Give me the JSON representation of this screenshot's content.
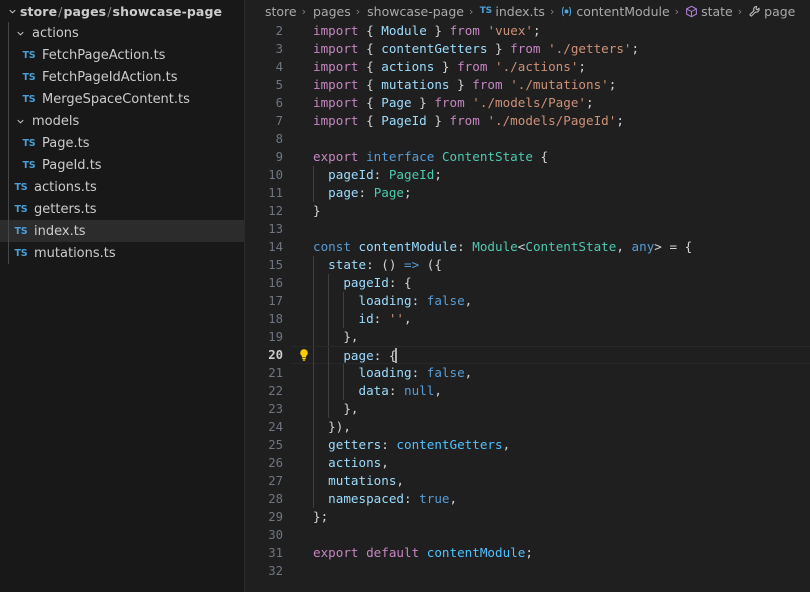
{
  "colors": {
    "editor_bg": "#1f1f1f",
    "sidebar_bg": "#181818",
    "selection_bg": "#2c2c2c",
    "accent_blue": "#4a9fd8",
    "lightbulb": "#ffcc00",
    "keyword": "#c586c0",
    "control": "#569cd6",
    "variable": "#9cdcfe",
    "type": "#4ec9b0",
    "string": "#ce9178",
    "punctuation": "#d4d4d4"
  },
  "sidebar": {
    "header": {
      "parts": [
        "store",
        "pages",
        "showcase-page"
      ],
      "separator": "/",
      "expanded": true
    },
    "items": [
      {
        "label": "actions",
        "kind": "folder",
        "depth": 1,
        "expanded": true,
        "selected": false
      },
      {
        "label": "FetchPageAction.ts",
        "kind": "file",
        "depth": 2,
        "selected": false
      },
      {
        "label": "FetchPageIdAction.ts",
        "kind": "file",
        "depth": 2,
        "selected": false
      },
      {
        "label": "MergeSpaceContent.ts",
        "kind": "file",
        "depth": 2,
        "selected": false
      },
      {
        "label": "models",
        "kind": "folder",
        "depth": 1,
        "expanded": true,
        "selected": false
      },
      {
        "label": "Page.ts",
        "kind": "file",
        "depth": 2,
        "selected": false
      },
      {
        "label": "PageId.ts",
        "kind": "file",
        "depth": 2,
        "selected": false
      },
      {
        "label": "actions.ts",
        "kind": "file",
        "depth": 1,
        "selected": false
      },
      {
        "label": "getters.ts",
        "kind": "file",
        "depth": 1,
        "selected": false
      },
      {
        "label": "index.ts",
        "kind": "file",
        "depth": 1,
        "selected": true
      },
      {
        "label": "mutations.ts",
        "kind": "file",
        "depth": 1,
        "selected": false
      }
    ],
    "file_icon_text": "TS"
  },
  "breadcrumbs": {
    "separator": "›",
    "items": [
      {
        "label": "store",
        "icon": "none"
      },
      {
        "label": "pages",
        "icon": "none"
      },
      {
        "label": "showcase-page",
        "icon": "none"
      },
      {
        "label": "index.ts",
        "icon": "typescript-file-icon",
        "icon_text": "TS"
      },
      {
        "label": "contentModule",
        "icon": "variable-symbol-icon",
        "icon_text": "[●]"
      },
      {
        "label": "state",
        "icon": "object-symbol-icon",
        "icon_text": "cube"
      },
      {
        "label": "page",
        "icon": "property-symbol-icon",
        "icon_text": "wrench"
      }
    ]
  },
  "editor": {
    "first_visible_line": 2,
    "active_line": 20,
    "lightbulb_line": 20,
    "cursor": {
      "line": 20,
      "after": "page: {"
    },
    "lines": [
      {
        "n": 2,
        "guides": [],
        "tokens": [
          {
            "t": "import",
            "c": "t-kw"
          },
          {
            "t": " ",
            "c": "t-pun"
          },
          {
            "t": "{",
            "c": "t-pun"
          },
          {
            "t": " ",
            "c": "t-pun"
          },
          {
            "t": "Module",
            "c": "t-var"
          },
          {
            "t": " ",
            "c": "t-pun"
          },
          {
            "t": "}",
            "c": "t-pun"
          },
          {
            "t": " ",
            "c": "t-pun"
          },
          {
            "t": "from",
            "c": "t-kw"
          },
          {
            "t": " ",
            "c": "t-pun"
          },
          {
            "t": "'vuex'",
            "c": "t-str"
          },
          {
            "t": ";",
            "c": "t-pun"
          }
        ]
      },
      {
        "n": 3,
        "guides": [],
        "tokens": [
          {
            "t": "import",
            "c": "t-kw"
          },
          {
            "t": " { ",
            "c": "t-pun"
          },
          {
            "t": "contentGetters",
            "c": "t-var"
          },
          {
            "t": " } ",
            "c": "t-pun"
          },
          {
            "t": "from",
            "c": "t-kw"
          },
          {
            "t": " ",
            "c": "t-pun"
          },
          {
            "t": "'./getters'",
            "c": "t-str"
          },
          {
            "t": ";",
            "c": "t-pun"
          }
        ]
      },
      {
        "n": 4,
        "guides": [],
        "tokens": [
          {
            "t": "import",
            "c": "t-kw"
          },
          {
            "t": " { ",
            "c": "t-pun"
          },
          {
            "t": "actions",
            "c": "t-var"
          },
          {
            "t": " } ",
            "c": "t-pun"
          },
          {
            "t": "from",
            "c": "t-kw"
          },
          {
            "t": " ",
            "c": "t-pun"
          },
          {
            "t": "'./actions'",
            "c": "t-str"
          },
          {
            "t": ";",
            "c": "t-pun"
          }
        ]
      },
      {
        "n": 5,
        "guides": [],
        "tokens": [
          {
            "t": "import",
            "c": "t-kw"
          },
          {
            "t": " { ",
            "c": "t-pun"
          },
          {
            "t": "mutations",
            "c": "t-var"
          },
          {
            "t": " } ",
            "c": "t-pun"
          },
          {
            "t": "from",
            "c": "t-kw"
          },
          {
            "t": " ",
            "c": "t-pun"
          },
          {
            "t": "'./mutations'",
            "c": "t-str"
          },
          {
            "t": ";",
            "c": "t-pun"
          }
        ]
      },
      {
        "n": 6,
        "guides": [],
        "tokens": [
          {
            "t": "import",
            "c": "t-kw"
          },
          {
            "t": " { ",
            "c": "t-pun"
          },
          {
            "t": "Page",
            "c": "t-var"
          },
          {
            "t": " } ",
            "c": "t-pun"
          },
          {
            "t": "from",
            "c": "t-kw"
          },
          {
            "t": " ",
            "c": "t-pun"
          },
          {
            "t": "'./models/Page'",
            "c": "t-str"
          },
          {
            "t": ";",
            "c": "t-pun"
          }
        ]
      },
      {
        "n": 7,
        "guides": [],
        "tokens": [
          {
            "t": "import",
            "c": "t-kw"
          },
          {
            "t": " { ",
            "c": "t-pun"
          },
          {
            "t": "PageId",
            "c": "t-var"
          },
          {
            "t": " } ",
            "c": "t-pun"
          },
          {
            "t": "from",
            "c": "t-kw"
          },
          {
            "t": " ",
            "c": "t-pun"
          },
          {
            "t": "'./models/PageId'",
            "c": "t-str"
          },
          {
            "t": ";",
            "c": "t-pun"
          }
        ]
      },
      {
        "n": 8,
        "guides": [],
        "tokens": []
      },
      {
        "n": 9,
        "guides": [],
        "tokens": [
          {
            "t": "export",
            "c": "t-kw"
          },
          {
            "t": " ",
            "c": "t-pun"
          },
          {
            "t": "interface",
            "c": "t-ctl"
          },
          {
            "t": " ",
            "c": "t-pun"
          },
          {
            "t": "ContentState",
            "c": "t-type"
          },
          {
            "t": " {",
            "c": "t-pun"
          }
        ]
      },
      {
        "n": 10,
        "guides": [
          0
        ],
        "tokens": [
          {
            "t": "  ",
            "c": "t-pun"
          },
          {
            "t": "pageId",
            "c": "t-var"
          },
          {
            "t": ": ",
            "c": "t-pun"
          },
          {
            "t": "PageId",
            "c": "t-type"
          },
          {
            "t": ";",
            "c": "t-pun"
          }
        ]
      },
      {
        "n": 11,
        "guides": [
          0
        ],
        "tokens": [
          {
            "t": "  ",
            "c": "t-pun"
          },
          {
            "t": "page",
            "c": "t-var"
          },
          {
            "t": ": ",
            "c": "t-pun"
          },
          {
            "t": "Page",
            "c": "t-type"
          },
          {
            "t": ";",
            "c": "t-pun"
          }
        ]
      },
      {
        "n": 12,
        "guides": [],
        "tokens": [
          {
            "t": "}",
            "c": "t-pun"
          }
        ]
      },
      {
        "n": 13,
        "guides": [],
        "tokens": []
      },
      {
        "n": 14,
        "guides": [],
        "tokens": [
          {
            "t": "const",
            "c": "t-ctl"
          },
          {
            "t": " ",
            "c": "t-pun"
          },
          {
            "t": "contentModule",
            "c": "t-var"
          },
          {
            "t": ": ",
            "c": "t-pun"
          },
          {
            "t": "Module",
            "c": "t-type"
          },
          {
            "t": "<",
            "c": "t-pun"
          },
          {
            "t": "ContentState",
            "c": "t-type"
          },
          {
            "t": ", ",
            "c": "t-pun"
          },
          {
            "t": "any",
            "c": "t-ctl"
          },
          {
            "t": "> = {",
            "c": "t-pun"
          }
        ]
      },
      {
        "n": 15,
        "guides": [
          0
        ],
        "tokens": [
          {
            "t": "  ",
            "c": "t-pun"
          },
          {
            "t": "state",
            "c": "t-var"
          },
          {
            "t": ": () ",
            "c": "t-pun"
          },
          {
            "t": "=>",
            "c": "t-op"
          },
          {
            "t": " ({",
            "c": "t-pun"
          }
        ]
      },
      {
        "n": 16,
        "guides": [
          0,
          1
        ],
        "tokens": [
          {
            "t": "    ",
            "c": "t-pun"
          },
          {
            "t": "pageId",
            "c": "t-var"
          },
          {
            "t": ": {",
            "c": "t-pun"
          }
        ]
      },
      {
        "n": 17,
        "guides": [
          0,
          1,
          2
        ],
        "tokens": [
          {
            "t": "      ",
            "c": "t-pun"
          },
          {
            "t": "loading",
            "c": "t-var"
          },
          {
            "t": ": ",
            "c": "t-pun"
          },
          {
            "t": "false",
            "c": "t-ctl"
          },
          {
            "t": ",",
            "c": "t-pun"
          }
        ]
      },
      {
        "n": 18,
        "guides": [
          0,
          1,
          2
        ],
        "tokens": [
          {
            "t": "      ",
            "c": "t-pun"
          },
          {
            "t": "id",
            "c": "t-var"
          },
          {
            "t": ": ",
            "c": "t-pun"
          },
          {
            "t": "''",
            "c": "t-str"
          },
          {
            "t": ",",
            "c": "t-pun"
          }
        ]
      },
      {
        "n": 19,
        "guides": [
          0,
          1
        ],
        "tokens": [
          {
            "t": "    },",
            "c": "t-pun"
          }
        ]
      },
      {
        "n": 20,
        "guides": [
          0,
          1
        ],
        "tokens": [
          {
            "t": "    ",
            "c": "t-pun"
          },
          {
            "t": "page",
            "c": "t-var"
          },
          {
            "t": ": {",
            "c": "t-pun"
          }
        ]
      },
      {
        "n": 21,
        "guides": [
          0,
          1,
          2
        ],
        "tokens": [
          {
            "t": "      ",
            "c": "t-pun"
          },
          {
            "t": "loading",
            "c": "t-var"
          },
          {
            "t": ": ",
            "c": "t-pun"
          },
          {
            "t": "false",
            "c": "t-ctl"
          },
          {
            "t": ",",
            "c": "t-pun"
          }
        ]
      },
      {
        "n": 22,
        "guides": [
          0,
          1,
          2
        ],
        "tokens": [
          {
            "t": "      ",
            "c": "t-pun"
          },
          {
            "t": "data",
            "c": "t-var"
          },
          {
            "t": ": ",
            "c": "t-pun"
          },
          {
            "t": "null",
            "c": "t-ctl"
          },
          {
            "t": ",",
            "c": "t-pun"
          }
        ]
      },
      {
        "n": 23,
        "guides": [
          0,
          1
        ],
        "tokens": [
          {
            "t": "    },",
            "c": "t-pun"
          }
        ]
      },
      {
        "n": 24,
        "guides": [
          0
        ],
        "tokens": [
          {
            "t": "  }),",
            "c": "t-pun"
          }
        ]
      },
      {
        "n": 25,
        "guides": [
          0
        ],
        "tokens": [
          {
            "t": "  ",
            "c": "t-pun"
          },
          {
            "t": "getters",
            "c": "t-var"
          },
          {
            "t": ": ",
            "c": "t-pun"
          },
          {
            "t": "contentGetters",
            "c": "t-fn"
          },
          {
            "t": ",",
            "c": "t-pun"
          }
        ]
      },
      {
        "n": 26,
        "guides": [
          0
        ],
        "tokens": [
          {
            "t": "  ",
            "c": "t-pun"
          },
          {
            "t": "actions",
            "c": "t-var"
          },
          {
            "t": ",",
            "c": "t-pun"
          }
        ]
      },
      {
        "n": 27,
        "guides": [
          0
        ],
        "tokens": [
          {
            "t": "  ",
            "c": "t-pun"
          },
          {
            "t": "mutations",
            "c": "t-var"
          },
          {
            "t": ",",
            "c": "t-pun"
          }
        ]
      },
      {
        "n": 28,
        "guides": [
          0
        ],
        "tokens": [
          {
            "t": "  ",
            "c": "t-pun"
          },
          {
            "t": "namespaced",
            "c": "t-var"
          },
          {
            "t": ": ",
            "c": "t-pun"
          },
          {
            "t": "true",
            "c": "t-ctl"
          },
          {
            "t": ",",
            "c": "t-pun"
          }
        ]
      },
      {
        "n": 29,
        "guides": [],
        "tokens": [
          {
            "t": "};",
            "c": "t-pun"
          }
        ]
      },
      {
        "n": 30,
        "guides": [],
        "tokens": []
      },
      {
        "n": 31,
        "guides": [],
        "tokens": [
          {
            "t": "export",
            "c": "t-kw"
          },
          {
            "t": " ",
            "c": "t-pun"
          },
          {
            "t": "default",
            "c": "t-kw"
          },
          {
            "t": " ",
            "c": "t-pun"
          },
          {
            "t": "contentModule",
            "c": "t-fn"
          },
          {
            "t": ";",
            "c": "t-pun"
          }
        ]
      },
      {
        "n": 32,
        "guides": [],
        "tokens": []
      }
    ]
  }
}
